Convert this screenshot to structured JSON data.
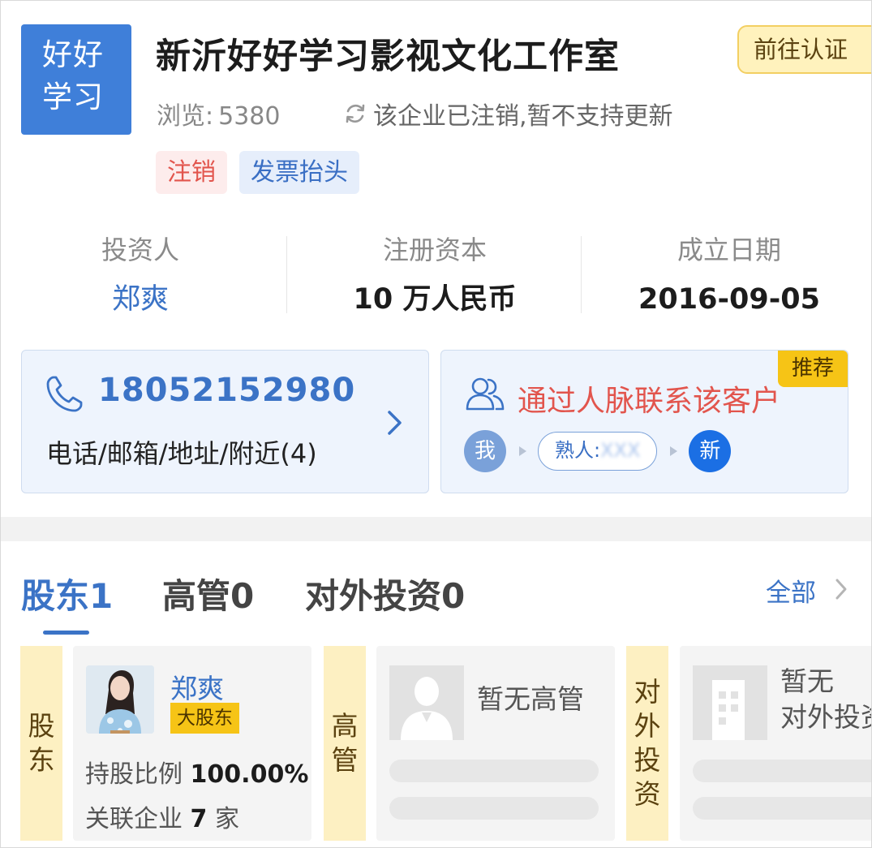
{
  "company": {
    "logo_lines": [
      "好好",
      "学习"
    ],
    "name": "新沂好好学习影视文化工作室",
    "verify_button": "前往认证",
    "views_label": "浏览:",
    "views_count": "5380",
    "status_note": "该企业已注销,暂不支持更新",
    "tags": [
      "注销",
      "发票抬头"
    ]
  },
  "stats": [
    {
      "label": "投资人",
      "value": "郑爽"
    },
    {
      "label": "注册资本",
      "value": "10 万人民币"
    },
    {
      "label": "成立日期",
      "value": "2016-09-05"
    }
  ],
  "contact": {
    "phone": "18052152980",
    "sub": "电话/邮箱/地址/附近(4)"
  },
  "network": {
    "badge": "推荐",
    "title": "通过人脉联系该客户",
    "me": "我",
    "acquaintance_label": "熟人:",
    "acquaintance_masked": "XXX",
    "target": "新"
  },
  "tabs": {
    "shareholders": "股东1",
    "executives": "高管0",
    "investments": "对外投资0",
    "view_all": "全部"
  },
  "sections": {
    "shareholder_label": "股东",
    "executive_label": "高管",
    "investment_label": "对外投资"
  },
  "shareholder": {
    "name": "郑爽",
    "badge": "大股东",
    "ratio_label": "持股比例",
    "ratio_value": "100.00%",
    "related_prefix": "关联企业",
    "related_count": "7",
    "related_suffix": "家"
  },
  "executive_empty": "暂无高管",
  "investment_empty": [
    "暂无",
    "对外投资"
  ],
  "colors": {
    "primary": "#3b73c6",
    "logo_bg": "#3f7fd9",
    "danger": "#e2554d",
    "badge_yellow": "#f6c416",
    "label_bg": "#fdf0c2"
  }
}
